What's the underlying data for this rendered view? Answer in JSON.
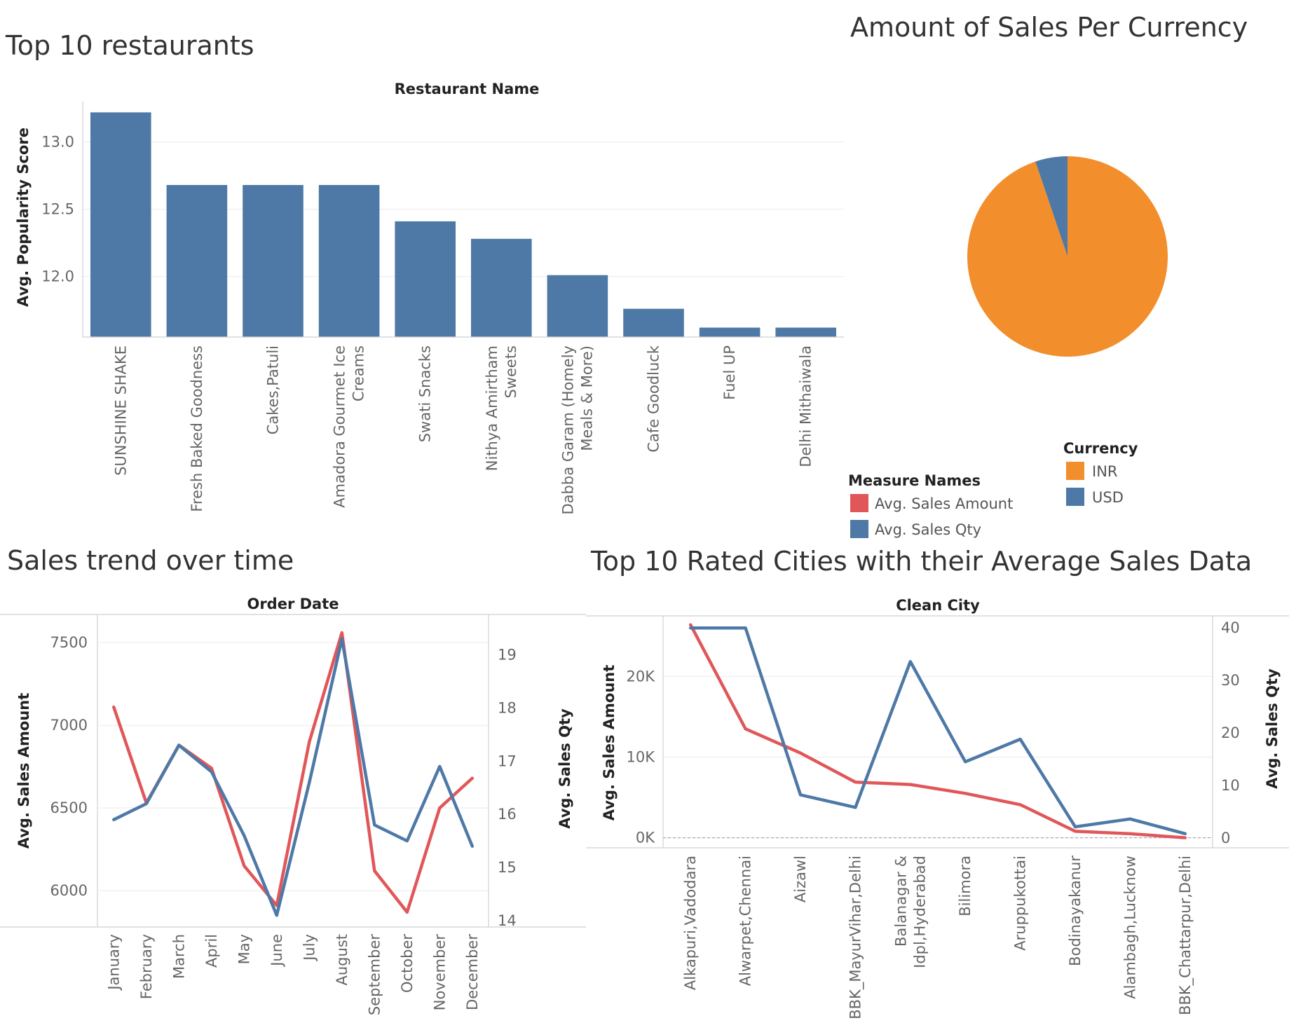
{
  "colors": {
    "bar": "#4e79a7",
    "inr": "#f28e2b",
    "usd": "#4e79a7",
    "amount_line": "#e15759",
    "qty_line": "#4e79a7"
  },
  "chart_data": [
    {
      "type": "bar",
      "title": "Top 10 restaurants",
      "header": "Restaurant Name",
      "ylabel": "Avg. Popularity Score",
      "ylim": [
        11.55,
        13.3
      ],
      "yticks": [
        12.0,
        12.5,
        13.0
      ],
      "ytick_labels": [
        "12.0",
        "12.5",
        "13.0"
      ],
      "categories": [
        [
          "SUNSHINE SHAKE"
        ],
        [
          "Fresh Baked Goodness"
        ],
        [
          "Cakes,Patuli"
        ],
        [
          "Amadora Gourmet Ice",
          "Creams"
        ],
        [
          "Swati Snacks"
        ],
        [
          "Nithya Amirtham",
          "Sweets"
        ],
        [
          "Dabba Garam (Homely",
          "Meals & More)"
        ],
        [
          "Cafe Goodluck"
        ],
        [
          "Fuel UP"
        ],
        [
          "Delhi Mithaiwala"
        ]
      ],
      "values": [
        13.22,
        12.68,
        12.68,
        12.68,
        12.41,
        12.28,
        12.01,
        11.76,
        11.62,
        11.62
      ]
    },
    {
      "type": "pie",
      "title": "Amount of Sales Per Currency",
      "legend_title": "Currency",
      "labels": [
        "INR",
        "USD"
      ],
      "values": [
        94.8,
        5.2
      ]
    },
    {
      "type": "line",
      "title": "Sales trend over time",
      "header": "Order Date",
      "categories": [
        "January",
        "February",
        "March",
        "April",
        "May",
        "June",
        "July",
        "August",
        "September",
        "October",
        "November",
        "December"
      ],
      "left_axis": {
        "label": "Avg. Sales Amount",
        "ylim": [
          5780,
          7670
        ],
        "ticks": [
          6000,
          6500,
          7000,
          7500
        ],
        "tick_labels": [
          "6000",
          "6500",
          "7000",
          "7500"
        ]
      },
      "right_axis": {
        "label": "Avg. Sales Qty",
        "ylim": [
          13.88,
          19.76
        ],
        "ticks": [
          14,
          15,
          16,
          17,
          18,
          19
        ],
        "tick_labels": [
          "14",
          "15",
          "16",
          "17",
          "18",
          "19"
        ]
      },
      "series": [
        {
          "name": "Avg. Sales Amount",
          "axis": "left",
          "values": [
            7110,
            6530,
            6880,
            6740,
            6150,
            5910,
            6900,
            7560,
            6120,
            5870,
            6500,
            6680
          ]
        },
        {
          "name": "Avg. Sales Qty",
          "axis": "right",
          "values": [
            15.9,
            16.2,
            17.3,
            16.8,
            15.6,
            14.1,
            16.6,
            19.3,
            15.8,
            15.5,
            16.9,
            15.4
          ]
        }
      ]
    },
    {
      "type": "line",
      "title": "Top 10 Rated Cities with their Average Sales Data",
      "header": "Clean City",
      "categories": [
        [
          "Alkapuri,Vadodara"
        ],
        [
          "Alwarpet,Chennai"
        ],
        [
          "Aizawl"
        ],
        [
          "BBK_MayurVihar,Delhi"
        ],
        [
          "Balanagar &",
          "Idpl,Hyderabad"
        ],
        [
          "Bilimora"
        ],
        [
          "Aruppukottai"
        ],
        [
          "Bodinayakanur"
        ],
        [
          "Alambagh,Lucknow"
        ],
        [
          "BBK_Chattarpur,Delhi"
        ]
      ],
      "left_axis": {
        "label": "Avg. Sales Amount",
        "ylim": [
          -1250,
          27500
        ],
        "ticks": [
          0,
          10000,
          20000
        ],
        "tick_labels": [
          "0K",
          "10K",
          "20K"
        ]
      },
      "right_axis": {
        "label": "Avg. Sales Qty",
        "ylim": [
          -1.9,
          42.3
        ],
        "ticks": [
          0,
          10,
          20,
          30,
          40
        ],
        "tick_labels": [
          "0",
          "10",
          "20",
          "30",
          "40"
        ]
      },
      "series": [
        {
          "name": "Avg. Sales Amount",
          "axis": "left",
          "values": [
            26400,
            13500,
            10500,
            6900,
            6600,
            5500,
            4100,
            800,
            500,
            0
          ]
        },
        {
          "name": "Avg. Sales Qty",
          "axis": "right",
          "values": [
            40.0,
            40.0,
            8.2,
            5.8,
            33.6,
            14.5,
            18.8,
            2.1,
            3.6,
            0.8
          ]
        }
      ]
    }
  ],
  "measure_legend": {
    "title": "Measure Names",
    "items": [
      "Avg. Sales Amount",
      "Avg. Sales Qty"
    ]
  }
}
